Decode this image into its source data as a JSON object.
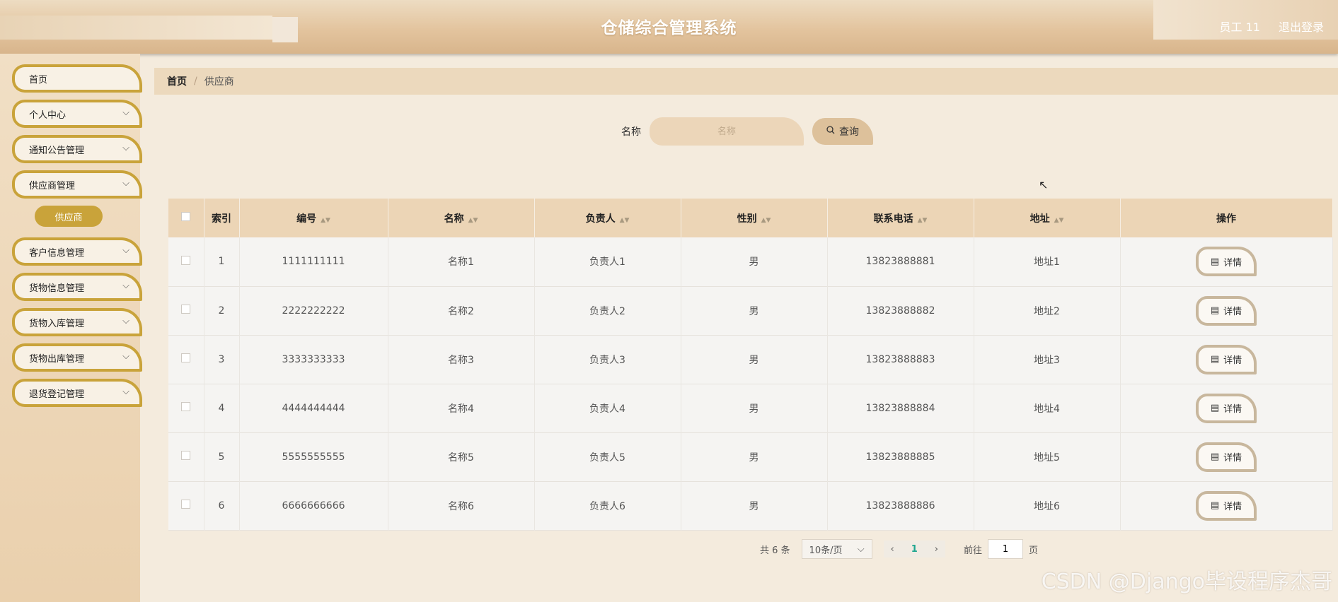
{
  "header": {
    "title": "仓储综合管理系统",
    "user": "员工 11",
    "logout": "退出登录"
  },
  "sidebar": {
    "items": [
      {
        "label": "首页",
        "has_chevron": false
      },
      {
        "label": "个人中心",
        "has_chevron": true
      },
      {
        "label": "通知公告管理",
        "has_chevron": true
      },
      {
        "label": "供应商管理",
        "has_chevron": true
      },
      {
        "label": "客户信息管理",
        "has_chevron": true
      },
      {
        "label": "货物信息管理",
        "has_chevron": true
      },
      {
        "label": "货物入库管理",
        "has_chevron": true
      },
      {
        "label": "货物出库管理",
        "has_chevron": true
      },
      {
        "label": "退货登记管理",
        "has_chevron": true
      }
    ],
    "submenu": {
      "label": "供应商"
    }
  },
  "breadcrumb": {
    "home": "首页",
    "separator": "/",
    "current": "供应商"
  },
  "search": {
    "label": "名称",
    "placeholder": "名称",
    "button": "查询"
  },
  "table": {
    "columns": [
      "索引",
      "编号",
      "名称",
      "负责人",
      "性别",
      "联系电话",
      "地址",
      "操作"
    ],
    "rows": [
      {
        "index": "1",
        "code": "1111111111",
        "name": "名称1",
        "manager": "负责人1",
        "gender": "男",
        "phone": "13823888881",
        "address": "地址1"
      },
      {
        "index": "2",
        "code": "2222222222",
        "name": "名称2",
        "manager": "负责人2",
        "gender": "男",
        "phone": "13823888882",
        "address": "地址2"
      },
      {
        "index": "3",
        "code": "3333333333",
        "name": "名称3",
        "manager": "负责人3",
        "gender": "男",
        "phone": "13823888883",
        "address": "地址3"
      },
      {
        "index": "4",
        "code": "4444444444",
        "name": "名称4",
        "manager": "负责人4",
        "gender": "男",
        "phone": "13823888884",
        "address": "地址4"
      },
      {
        "index": "5",
        "code": "5555555555",
        "name": "名称5",
        "manager": "负责人5",
        "gender": "男",
        "phone": "13823888885",
        "address": "地址5"
      },
      {
        "index": "6",
        "code": "6666666666",
        "name": "名称6",
        "manager": "负责人6",
        "gender": "男",
        "phone": "13823888886",
        "address": "地址6"
      }
    ],
    "detail_label": "详情"
  },
  "pagination": {
    "total": "共 6 条",
    "page_size": "10条/页",
    "current_page": "1",
    "goto_label": "前往",
    "goto_value": "1",
    "page_suffix": "页"
  },
  "watermark": "CSDN @Django毕设程序杰哥",
  "colors": {
    "accent": "#c9a33a",
    "header_bg": "#e3c49e",
    "table_header_bg": "#ecd5b6",
    "page_active": "#1ea68f"
  }
}
